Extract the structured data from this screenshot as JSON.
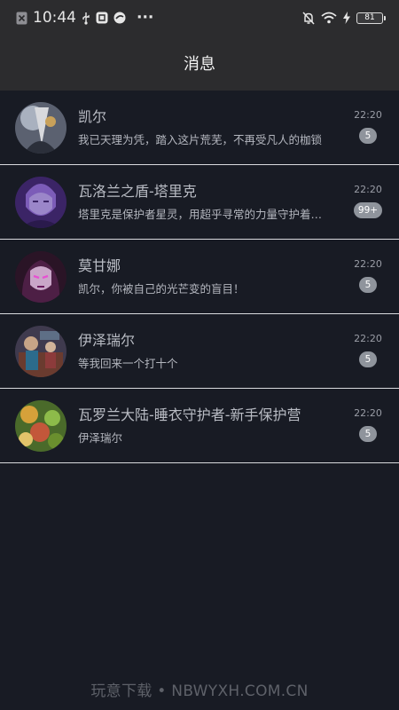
{
  "status_bar": {
    "time": "10:44",
    "battery": "81",
    "icons_left": [
      "notification-x-icon",
      "usb-icon",
      "app-icon",
      "app-icon-2",
      "more-dots-icon"
    ],
    "icons_right": [
      "mute-bell-icon",
      "wifi-icon",
      "charging-icon",
      "battery-icon"
    ],
    "more": "···"
  },
  "header": {
    "title": "消息"
  },
  "conversations": [
    {
      "name": "凯尔",
      "preview": "我已天理为凭，踏入这片荒芜，不再受凡人的枷锁",
      "time": "22:20",
      "unread": "5"
    },
    {
      "name": "瓦洛兰之盾-塔里克",
      "preview": "塔里克是保护者星灵，用超乎寻常的力量守护着符文之地",
      "time": "22:20",
      "unread": "99+"
    },
    {
      "name": "莫甘娜",
      "preview": "凯尔，你被自己的光芒变的盲目！",
      "time": "22:20",
      "unread": "5"
    },
    {
      "name": "伊泽瑞尔",
      "preview": "等我回来一个打十个",
      "time": "22:20",
      "unread": "5"
    },
    {
      "name": "瓦罗兰大陆-睡衣守护者-新手保护营",
      "preview": "伊泽瑞尔",
      "time": "22:20",
      "unread": "5"
    }
  ],
  "watermark": "玩意下载 • NBWYXH.COM.CN",
  "colors": {
    "background": "#181b24",
    "bar": "#2c2c2e",
    "badge": "#8f949c",
    "divider": "#d9dade"
  }
}
